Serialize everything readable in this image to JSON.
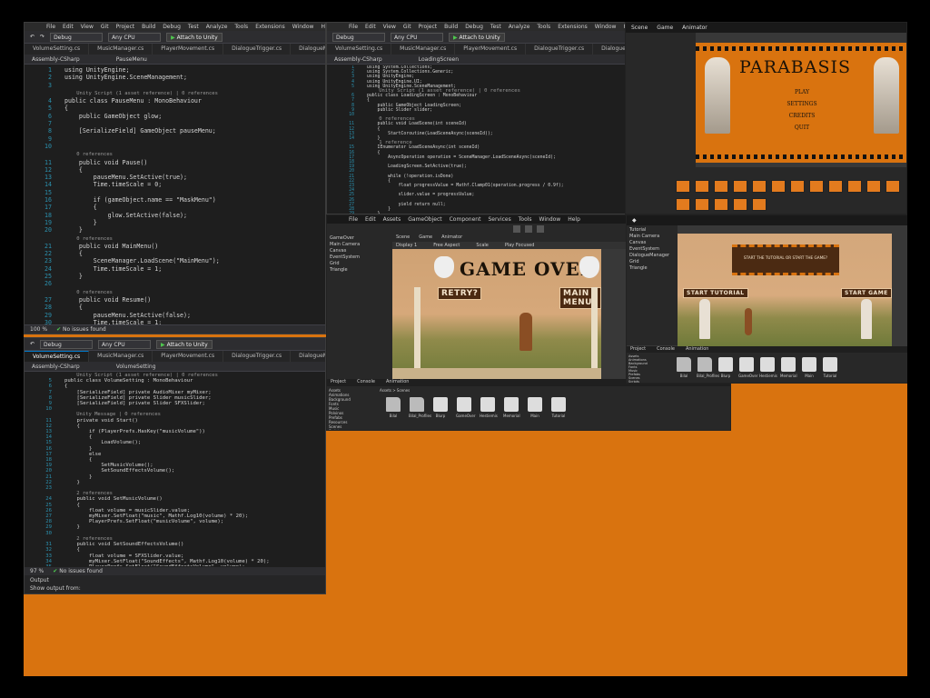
{
  "colors": {
    "board": "#d9730f",
    "ide_bg": "#1e1e1e",
    "unity_bg": "#383838",
    "accent": "#007acc"
  },
  "vs1": {
    "menu": [
      "File",
      "Edit",
      "View",
      "Git",
      "Project",
      "Build",
      "Debug",
      "Test",
      "Analyze",
      "Tools",
      "Extensions",
      "Window",
      "Help"
    ],
    "config": "Debug",
    "platform": "Any CPU",
    "attach": "Attach to Unity",
    "tabs": [
      "VolumeSetting.cs",
      "MusicManager.cs",
      "PlayerMovement.cs",
      "DialogueTrigger.cs",
      "DialogueManager.cs"
    ],
    "assembly": "Assembly-CSharp",
    "member": "PauseMenu",
    "lines": [
      {
        "n": "1",
        "t": "using UnityEngine;"
      },
      {
        "n": "2",
        "t": "using UnityEngine.SceneManagement;"
      },
      {
        "n": "3",
        "t": ""
      },
      {
        "n": "",
        "t": "    Unity Script (1 asset reference) | 0 references",
        "c": true
      },
      {
        "n": "4",
        "t": "public class PauseMenu : MonoBehaviour"
      },
      {
        "n": "5",
        "t": "{"
      },
      {
        "n": "6",
        "t": "    public GameObject glow;"
      },
      {
        "n": "7",
        "t": ""
      },
      {
        "n": "8",
        "t": "    [SerializeField] GameObject pauseMenu;"
      },
      {
        "n": "9",
        "t": ""
      },
      {
        "n": "10",
        "t": ""
      },
      {
        "n": "",
        "t": "    0 references",
        "c": true
      },
      {
        "n": "11",
        "t": "    public void Pause()"
      },
      {
        "n": "12",
        "t": "    {"
      },
      {
        "n": "13",
        "t": "        pauseMenu.SetActive(true);"
      },
      {
        "n": "14",
        "t": "        Time.timeScale = 0;"
      },
      {
        "n": "15",
        "t": ""
      },
      {
        "n": "16",
        "t": "        if (gameObject.name == \"MaskMenu\")"
      },
      {
        "n": "17",
        "t": "        {"
      },
      {
        "n": "18",
        "t": "            glow.SetActive(false);"
      },
      {
        "n": "19",
        "t": "        }"
      },
      {
        "n": "20",
        "t": "    }"
      },
      {
        "n": "",
        "t": "    0 references",
        "c": true
      },
      {
        "n": "21",
        "t": "    public void MainMenu()"
      },
      {
        "n": "22",
        "t": "    {"
      },
      {
        "n": "23",
        "t": "        SceneManager.LoadScene(\"MainMenu\");"
      },
      {
        "n": "24",
        "t": "        Time.timeScale = 1;"
      },
      {
        "n": "25",
        "t": "    }"
      },
      {
        "n": "26",
        "t": ""
      },
      {
        "n": "",
        "t": "    0 references",
        "c": true
      },
      {
        "n": "27",
        "t": "    public void Resume()"
      },
      {
        "n": "28",
        "t": "    {"
      },
      {
        "n": "29",
        "t": "        pauseMenu.SetActive(false);"
      },
      {
        "n": "30",
        "t": "        Time.timeScale = 1;"
      },
      {
        "n": "31",
        "t": "    }"
      },
      {
        "n": "32",
        "t": ""
      },
      {
        "n": "",
        "t": "    0 references",
        "c": true
      },
      {
        "n": "33",
        "t": "    public void Restart()"
      },
      {
        "n": "34",
        "t": "    {"
      },
      {
        "n": "35",
        "t": "        SceneManager.LoadScene(SceneManager.GetActiveScene().buildIndex);"
      }
    ],
    "zoom": "100 %",
    "issues": "No issues found"
  },
  "vs2": {
    "tabs": [
      "VolumeSetting.cs",
      "MusicManager.cs",
      "PlayerMovement.cs",
      "DialogueTrigger.cs",
      "DialogueManager.cs",
      "GOMM.cs"
    ],
    "assembly": "Assembly-CSharp",
    "member": "VolumeSetting",
    "lines": [
      {
        "n": "",
        "t": "    Unity Script (1 asset reference) | 0 references",
        "c": true
      },
      {
        "n": "5",
        "t": "public class VolumeSetting : MonoBehaviour"
      },
      {
        "n": "6",
        "t": "{"
      },
      {
        "n": "7",
        "t": "    [SerializeField] private AudioMixer myMixer;"
      },
      {
        "n": "8",
        "t": "    [SerializeField] private Slider musicSlider;"
      },
      {
        "n": "9",
        "t": "    [SerializeField] private Slider SFXSlider;"
      },
      {
        "n": "10",
        "t": ""
      },
      {
        "n": "",
        "t": "    Unity Message | 0 references",
        "c": true
      },
      {
        "n": "11",
        "t": "    private void Start()"
      },
      {
        "n": "12",
        "t": "    {"
      },
      {
        "n": "13",
        "t": "        if (PlayerPrefs.HasKey(\"musicVolume\"))"
      },
      {
        "n": "14",
        "t": "        {"
      },
      {
        "n": "15",
        "t": "            LoadVolume();"
      },
      {
        "n": "16",
        "t": "        }"
      },
      {
        "n": "17",
        "t": "        else"
      },
      {
        "n": "18",
        "t": "        {"
      },
      {
        "n": "19",
        "t": "            SetMusicVolume();"
      },
      {
        "n": "20",
        "t": "            SetSoundEffectsVolume();"
      },
      {
        "n": "21",
        "t": "        }"
      },
      {
        "n": "22",
        "t": "    }"
      },
      {
        "n": "23",
        "t": ""
      },
      {
        "n": "",
        "t": "    2 references",
        "c": true
      },
      {
        "n": "24",
        "t": "    public void SetMusicVolume()"
      },
      {
        "n": "25",
        "t": "    {"
      },
      {
        "n": "26",
        "t": "        float volume = musicSlider.value;"
      },
      {
        "n": "27",
        "t": "        myMixer.SetFloat(\"music\", Mathf.Log10(volume) * 20);"
      },
      {
        "n": "28",
        "t": "        PlayerPrefs.SetFloat(\"musicVolume\", volume);"
      },
      {
        "n": "29",
        "t": "    }"
      },
      {
        "n": "30",
        "t": ""
      },
      {
        "n": "",
        "t": "    2 references",
        "c": true
      },
      {
        "n": "31",
        "t": "    public void SetSoundEffectsVolume()"
      },
      {
        "n": "32",
        "t": "    {"
      },
      {
        "n": "33",
        "t": "        float volume = SFXSlider.value;"
      },
      {
        "n": "34",
        "t": "        myMixer.SetFloat(\"SoundEffects\", Mathf.Log10(volume) * 20);"
      },
      {
        "n": "35",
        "t": "        PlayerPrefs.SetFloat(\"SoundEffectsVolume\", volume);"
      },
      {
        "n": "36",
        "t": "    }"
      },
      {
        "n": "",
        "t": "    1 reference",
        "c": true
      },
      {
        "n": "37",
        "t": "    private void LoadVolume()"
      },
      {
        "n": "38",
        "t": "    {"
      }
    ],
    "zoom": "97 %",
    "issues": "No issues found",
    "output": "Output",
    "output_from": "Show output from:"
  },
  "vs3": {
    "tabs": [
      "VolumeSetting.cs",
      "MusicManager.cs",
      "PlayerMovement.cs",
      "DialogueTrigger.cs",
      "DialogueManager.cs",
      "Dialogue.cs",
      "GOMM.cs",
      "MenuManager.cs"
    ],
    "assembly": "Assembly-CSharp",
    "member": "LoadingScreen",
    "lines": [
      {
        "n": "1",
        "t": "using System.Collections;"
      },
      {
        "n": "2",
        "t": "using System.Collections.Generic;"
      },
      {
        "n": "3",
        "t": "using UnityEngine;"
      },
      {
        "n": "4",
        "t": "using UnityEngine.UI;"
      },
      {
        "n": "5",
        "t": "using UnityEngine.SceneManagement;"
      },
      {
        "n": "",
        "t": "    Unity Script (1 asset reference) | 0 references",
        "c": true
      },
      {
        "n": "6",
        "t": "public class LoadingScreen : MonoBehaviour"
      },
      {
        "n": "7",
        "t": "{"
      },
      {
        "n": "8",
        "t": "    public GameObject LoadingScreen;"
      },
      {
        "n": "9",
        "t": "    public Slider slider;"
      },
      {
        "n": "10",
        "t": ""
      },
      {
        "n": "",
        "t": "    0 references",
        "c": true
      },
      {
        "n": "11",
        "t": "    public void LoadScene(int sceneId)"
      },
      {
        "n": "12",
        "t": "    {"
      },
      {
        "n": "13",
        "t": "        StartCoroutine(LoadSceneAsync(sceneId));"
      },
      {
        "n": "14",
        "t": "    }"
      },
      {
        "n": "",
        "t": "    1 reference",
        "c": true
      },
      {
        "n": "15",
        "t": "    IEnumerator LoadSceneAsync(int sceneId)"
      },
      {
        "n": "16",
        "t": "    {"
      },
      {
        "n": "17",
        "t": "        AsyncOperation operation = SceneManager.LoadSceneAsync(sceneId);"
      },
      {
        "n": "18",
        "t": ""
      },
      {
        "n": "19",
        "t": "        LoadingScreen.SetActive(true);"
      },
      {
        "n": "20",
        "t": ""
      },
      {
        "n": "21",
        "t": "        while (!operation.isDone)"
      },
      {
        "n": "22",
        "t": "        {"
      },
      {
        "n": "23",
        "t": "            float progressValue = Mathf.Clamp01(operation.progress / 0.9f);"
      },
      {
        "n": "24",
        "t": ""
      },
      {
        "n": "25",
        "t": "            slider.value = progressValue;"
      },
      {
        "n": "26",
        "t": ""
      },
      {
        "n": "27",
        "t": "            yield return null;"
      },
      {
        "n": "28",
        "t": "        }"
      },
      {
        "n": "29",
        "t": "    }"
      }
    ]
  },
  "unity_menu": {
    "title": "PARABASIS",
    "items": [
      "PLAY",
      "SETTINGS",
      "CREDITS",
      "QUIT"
    ],
    "tabs": [
      "Scene",
      "Game",
      "Animator"
    ]
  },
  "unity_gameover": {
    "menu": [
      "File",
      "Edit",
      "Assets",
      "GameObject",
      "Component",
      "Services",
      "Tools",
      "Window",
      "Help"
    ],
    "hierarchy": [
      "GameOver",
      "Main Camera",
      "Canvas",
      "EventSystem",
      "Grid",
      "Triangle"
    ],
    "tabs": [
      "Scene",
      "Game",
      "Animator"
    ],
    "display": "Display 1",
    "aspect": "Free Aspect",
    "scale": "Scale",
    "play_mode": "Play Focused",
    "title": "GAME OVER",
    "retry": "RETRY?",
    "main_menu": "MAIN MENU?",
    "proj_tabs": [
      "Project",
      "Console",
      "Animation"
    ],
    "breadcrumb": "Assets > Scenes",
    "tree": [
      "Assets",
      "Animations",
      "Background",
      "Fonts",
      "Music",
      "Polvinos",
      "Prefabs",
      "Resources",
      "Scenes",
      "Scripts"
    ],
    "assets": [
      "Bilal",
      "Bilal_Profiles",
      "Blurp",
      "GameOver",
      "Hestiemis",
      "Memorial",
      "Main",
      "Tutorial"
    ]
  },
  "unity_tutorial": {
    "question": "START THE TUTORIAL OR START THE GAME?",
    "start_tutorial": "START TUTORIAL",
    "start_game": "START GAME",
    "hierarchy": [
      "Tutorial",
      "Main Camera",
      "Canvas",
      "EventSystem",
      "DialogueManager",
      "Grid",
      "Triangle"
    ],
    "proj_tabs": [
      "Project",
      "Console",
      "Animation"
    ],
    "tree": [
      "Assets",
      "Animations",
      "Background",
      "Fonts",
      "Music",
      "Prefabs",
      "Scenes",
      "Scripts"
    ],
    "assets": [
      "Bilal",
      "Bilal_Profiles",
      "Blurp",
      "GameOver",
      "Hestiemis",
      "Memorial",
      "Main",
      "Tutorial"
    ]
  }
}
